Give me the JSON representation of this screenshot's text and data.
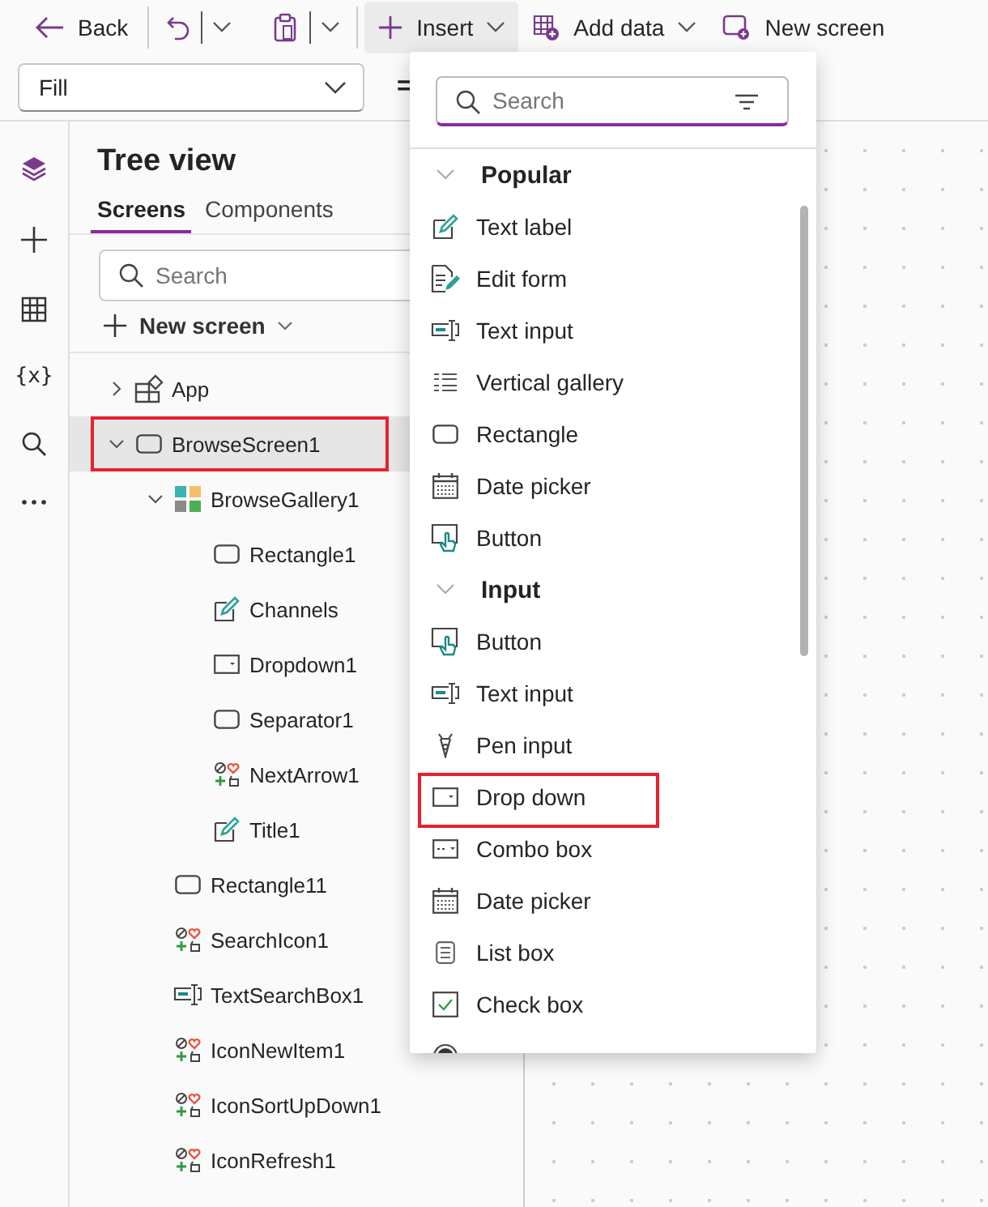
{
  "toolbar": {
    "back": "Back",
    "insert": {
      "label": "Insert",
      "selected": true
    },
    "add_data": "Add data",
    "new_screen": "New screen"
  },
  "formula_bar": {
    "property": "Fill",
    "equals": "="
  },
  "rail": {
    "variables_icon": "{x}"
  },
  "tree_view": {
    "title": "Tree view",
    "tabs": [
      {
        "label": "Screens",
        "selected": true
      },
      {
        "label": "Components",
        "selected": false
      }
    ],
    "search": {
      "placeholder": "Search"
    },
    "new_screen": "New screen",
    "items": [
      {
        "label": "App",
        "kind": "app",
        "expanded": false,
        "selected": false,
        "highlighted": false
      },
      {
        "label": "BrowseScreen1",
        "kind": "screen",
        "expanded": true,
        "selected": true,
        "highlighted": true,
        "children": [
          {
            "label": "BrowseGallery1",
            "kind": "gallery",
            "expanded": true,
            "selected": false,
            "highlighted": false,
            "children": [
              {
                "label": "Rectangle1",
                "kind": "rectangle",
                "selected": false,
                "highlighted": false
              },
              {
                "label": "Channels",
                "kind": "label",
                "selected": false,
                "highlighted": false
              },
              {
                "label": "Dropdown1",
                "kind": "dropdown",
                "selected": false,
                "highlighted": false
              },
              {
                "label": "Separator1",
                "kind": "rectangle",
                "selected": false,
                "highlighted": false
              },
              {
                "label": "NextArrow1",
                "kind": "icon",
                "selected": false,
                "highlighted": false
              },
              {
                "label": "Title1",
                "kind": "label",
                "selected": false,
                "highlighted": false
              }
            ]
          },
          {
            "label": "Rectangle11",
            "kind": "rectangle",
            "selected": false,
            "highlighted": false
          },
          {
            "label": "SearchIcon1",
            "kind": "icon",
            "selected": false,
            "highlighted": false
          },
          {
            "label": "TextSearchBox1",
            "kind": "textinput",
            "selected": false,
            "highlighted": false
          },
          {
            "label": "IconNewItem1",
            "kind": "icon",
            "selected": false,
            "highlighted": false
          },
          {
            "label": "IconSortUpDown1",
            "kind": "icon",
            "selected": false,
            "highlighted": false
          },
          {
            "label": "IconRefresh1",
            "kind": "icon",
            "selected": false,
            "highlighted": false
          }
        ]
      }
    ]
  },
  "insert_menu": {
    "search": {
      "placeholder": "Search"
    },
    "sections": [
      {
        "title": "Popular",
        "expanded": true,
        "items": [
          {
            "label": "Text label",
            "kind": "label",
            "highlighted": false
          },
          {
            "label": "Edit form",
            "kind": "form",
            "highlighted": false
          },
          {
            "label": "Text input",
            "kind": "textinput",
            "highlighted": false
          },
          {
            "label": "Vertical gallery",
            "kind": "list",
            "highlighted": false
          },
          {
            "label": "Rectangle",
            "kind": "rectangle",
            "highlighted": false
          },
          {
            "label": "Date picker",
            "kind": "date",
            "highlighted": false
          },
          {
            "label": "Button",
            "kind": "button",
            "highlighted": false
          }
        ]
      },
      {
        "title": "Input",
        "expanded": true,
        "items": [
          {
            "label": "Button",
            "kind": "button",
            "highlighted": false
          },
          {
            "label": "Text input",
            "kind": "textinput",
            "highlighted": false
          },
          {
            "label": "Pen input",
            "kind": "pen",
            "highlighted": false
          },
          {
            "label": "Drop down",
            "kind": "dropdown",
            "highlighted": true
          },
          {
            "label": "Combo box",
            "kind": "combo",
            "highlighted": false
          },
          {
            "label": "Date picker",
            "kind": "date",
            "highlighted": false
          },
          {
            "label": "List box",
            "kind": "listbox",
            "highlighted": false
          },
          {
            "label": "Check box",
            "kind": "checkbox",
            "highlighted": false
          }
        ]
      }
    ]
  }
}
